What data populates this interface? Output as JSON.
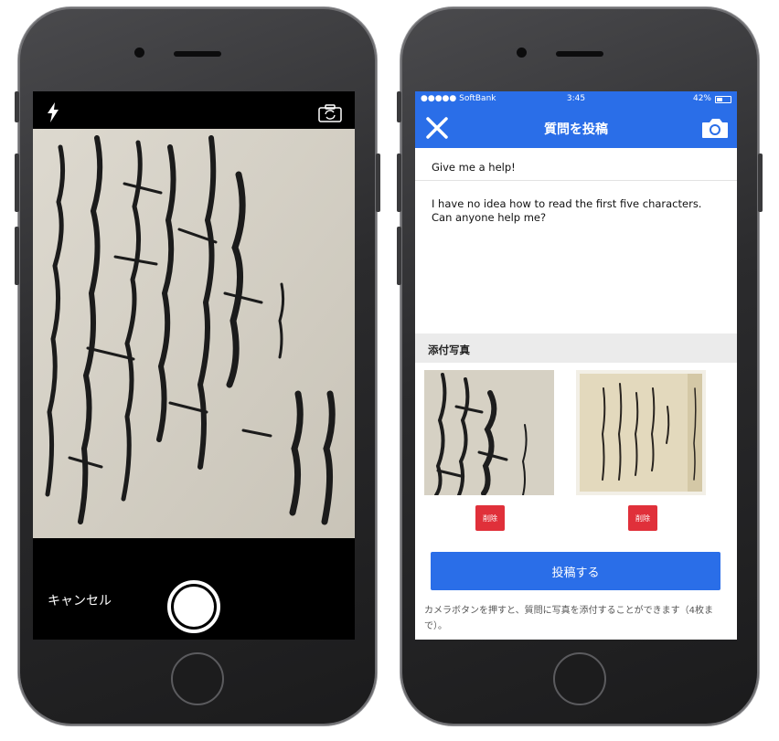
{
  "camera_screen": {
    "cancel_label": "キャンセル",
    "icons": {
      "flash": "flash-icon",
      "switch_camera": "switch-camera-icon",
      "shutter": "shutter-button"
    }
  },
  "app_screen": {
    "status_bar": {
      "carrier": "●●●●● SoftBank",
      "time": "3:45",
      "battery": "42%"
    },
    "nav": {
      "title": "質問を投稿",
      "close_icon": "close-icon",
      "camera_icon": "camera-icon"
    },
    "form": {
      "title_value": "Give me a help!",
      "body_value": "I have no idea how to read the first five characters. Can anyone help me?"
    },
    "attachments": {
      "section_title": "添付写真",
      "delete_label": "削除",
      "count": 2
    },
    "submit_label": "投稿する",
    "help_text": "カメラボタンを押すと、質問に写真を添付することができます（4枚まで）。"
  },
  "colors": {
    "accent": "#2a6ee8",
    "delete": "#e0303a",
    "section_bg": "#ebebeb"
  }
}
